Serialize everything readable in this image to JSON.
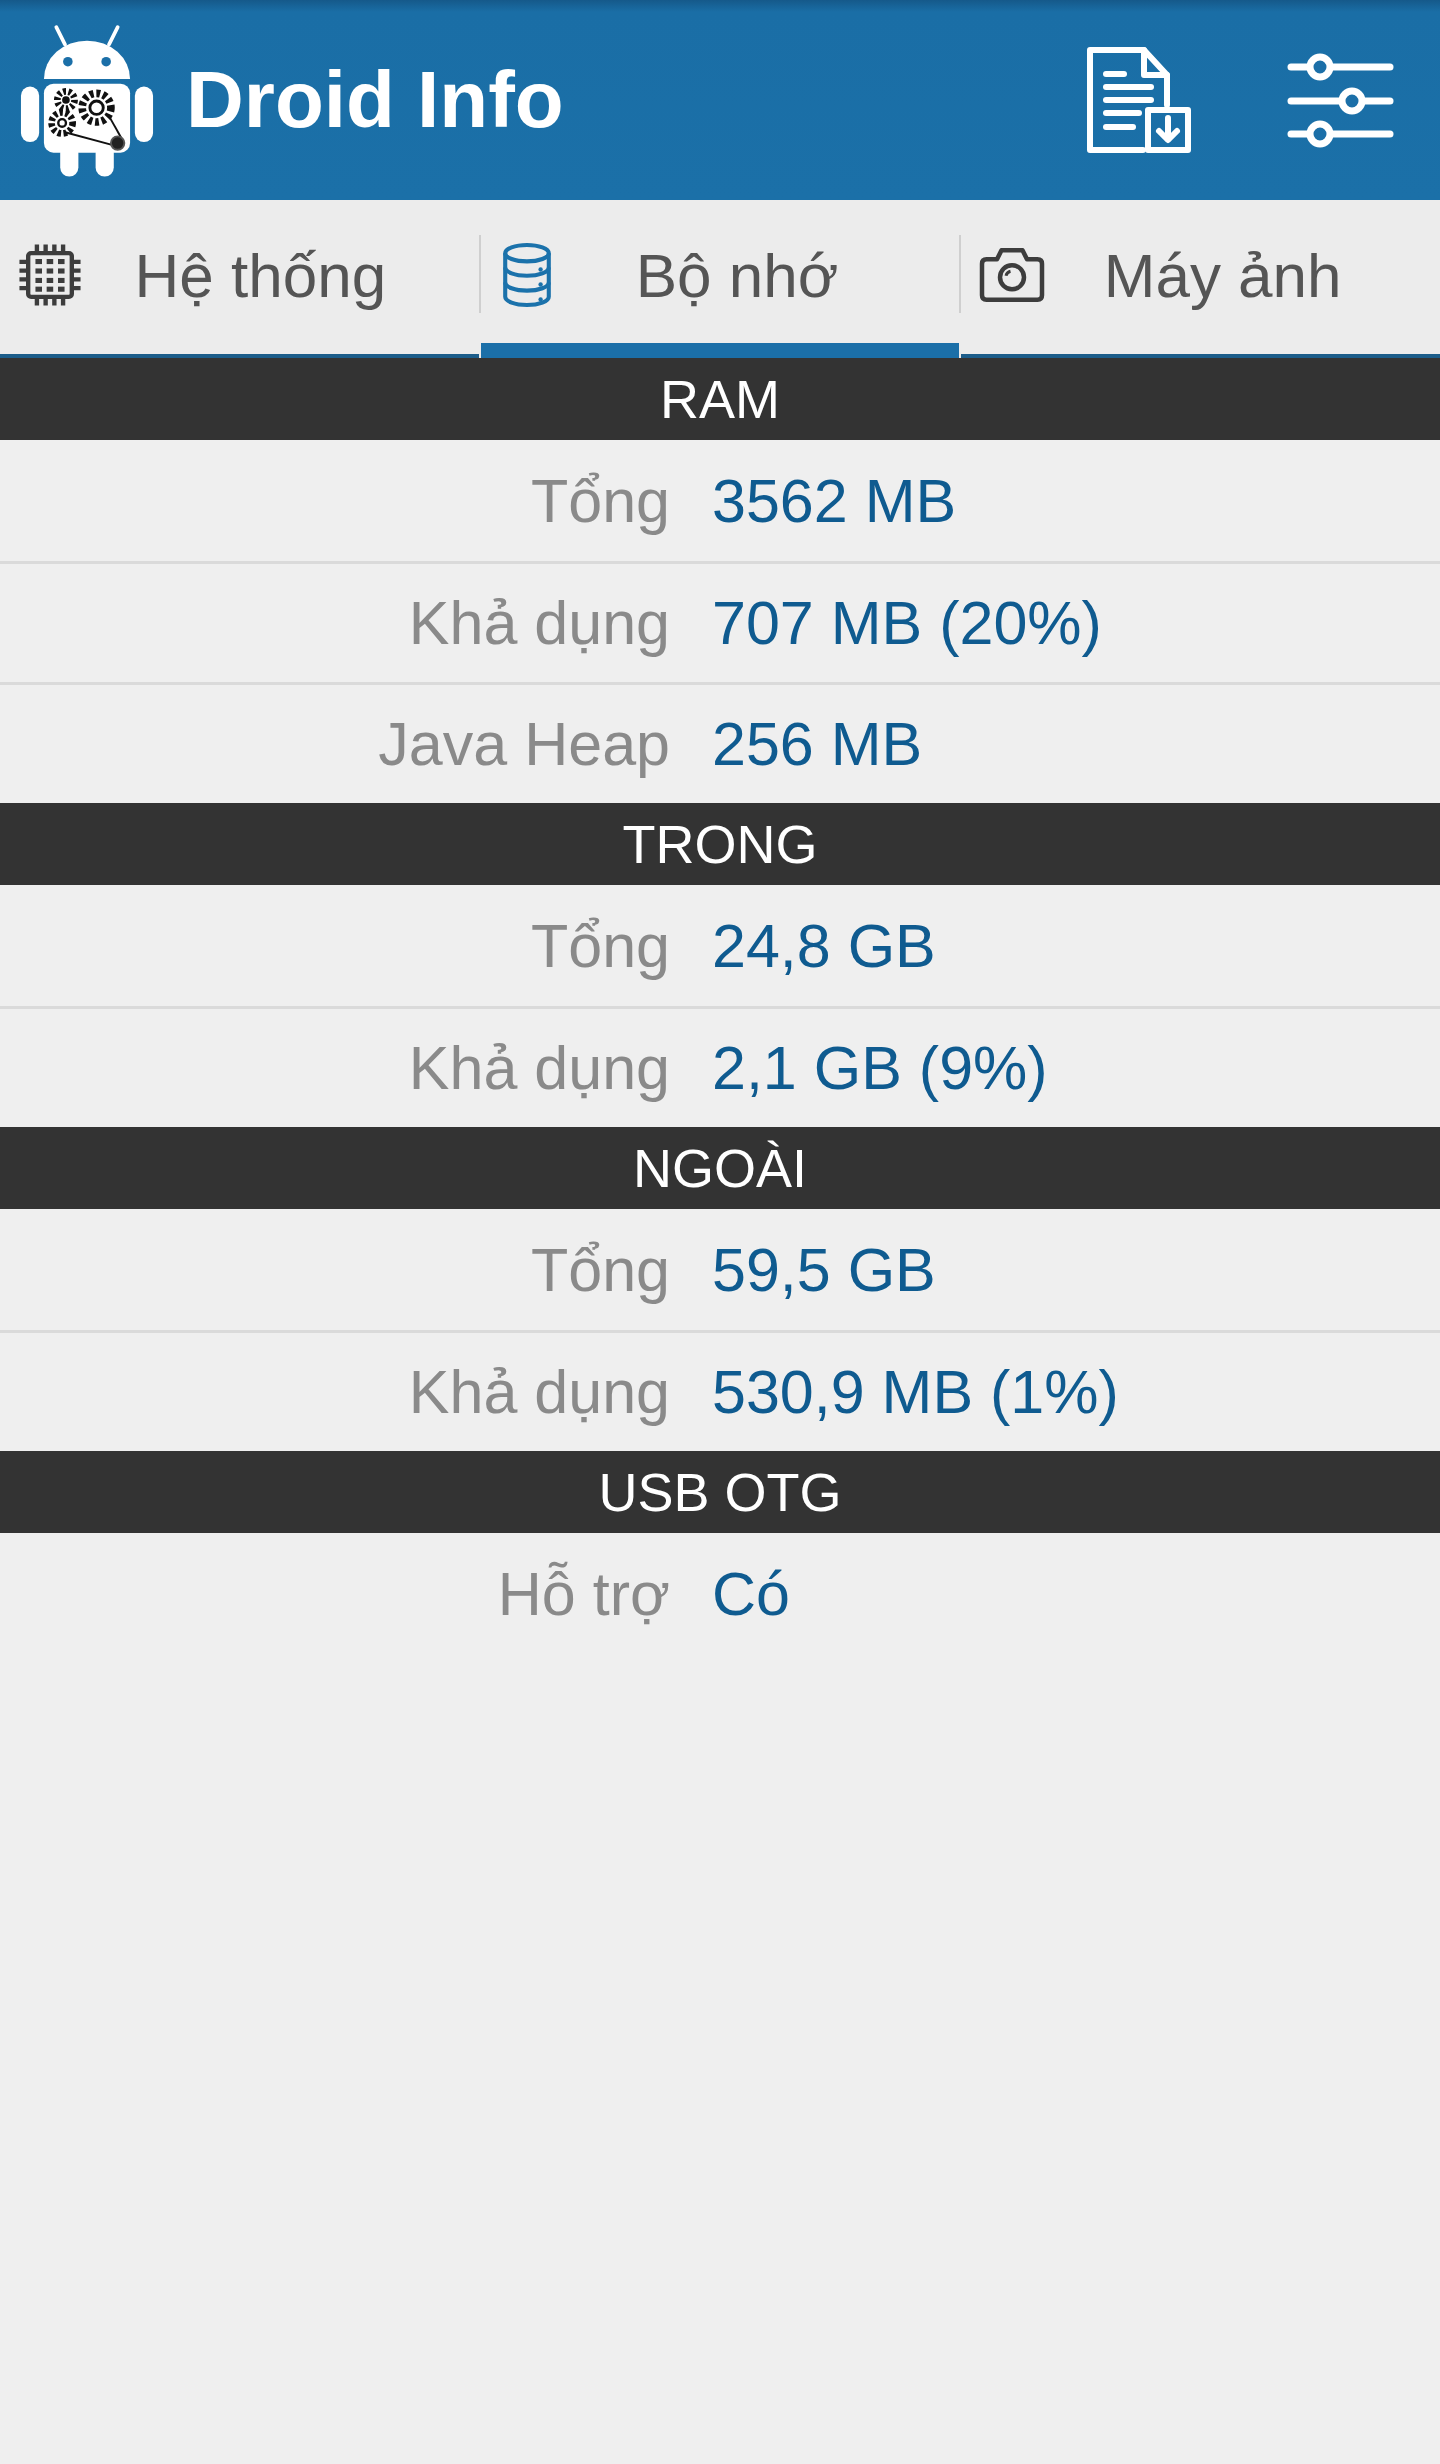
{
  "app_bar": {
    "title": "Droid Info"
  },
  "tabs": [
    {
      "label": "Hệ thống",
      "selected": false
    },
    {
      "label": "Bộ nhớ",
      "selected": true
    },
    {
      "label": "Máy ảnh",
      "selected": false
    }
  ],
  "sections": [
    {
      "title": "RAM",
      "rows": [
        {
          "label": "Tổng",
          "value": "3562 MB"
        },
        {
          "label": "Khả dụng",
          "value": "707 MB (20%)"
        },
        {
          "label": "Java Heap",
          "value": "256 MB"
        }
      ]
    },
    {
      "title": "TRONG",
      "rows": [
        {
          "label": "Tổng",
          "value": "24,8 GB"
        },
        {
          "label": "Khả dụng",
          "value": "2,1 GB (9%)"
        }
      ]
    },
    {
      "title": "NGOÀI",
      "rows": [
        {
          "label": "Tổng",
          "value": "59,5 GB"
        },
        {
          "label": "Khả dụng",
          "value": "530,9 MB (1%)"
        }
      ]
    },
    {
      "title": "USB OTG",
      "rows": [
        {
          "label": "Hỗ trợ",
          "value": "Có"
        }
      ]
    }
  ]
}
